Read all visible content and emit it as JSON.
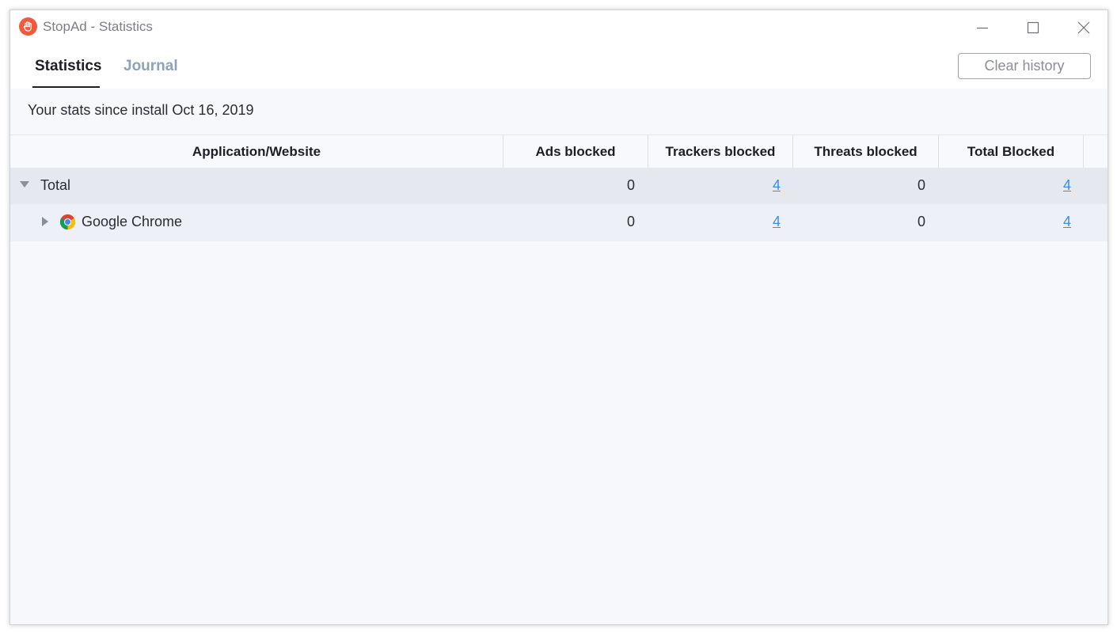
{
  "window": {
    "title": "StopAd - Statistics",
    "controls": [
      "minimize-icon",
      "maximize-icon",
      "close-icon"
    ]
  },
  "tabs": [
    {
      "label": "Statistics",
      "active": true
    },
    {
      "label": "Journal",
      "active": false
    }
  ],
  "toolbar": {
    "clear_history_label": "Clear history"
  },
  "since_text": "Your stats since install Oct 16, 2019",
  "table": {
    "columns": [
      "Application/Website",
      "Ads blocked",
      "Trackers blocked",
      "Threats blocked",
      "Total Blocked"
    ],
    "rows": [
      {
        "label": "Total",
        "expanded": true,
        "ads": "0",
        "trackers": "4",
        "threats": "0",
        "total": "4"
      },
      {
        "label": "Google Chrome",
        "expanded": false,
        "icon": "chrome-icon",
        "ads": "0",
        "trackers": "4",
        "threats": "0",
        "total": "4"
      }
    ]
  },
  "colors": {
    "brand": "#ee5a3c",
    "link": "#3b8fe0",
    "inactive_tab": "#8fa3b8"
  }
}
